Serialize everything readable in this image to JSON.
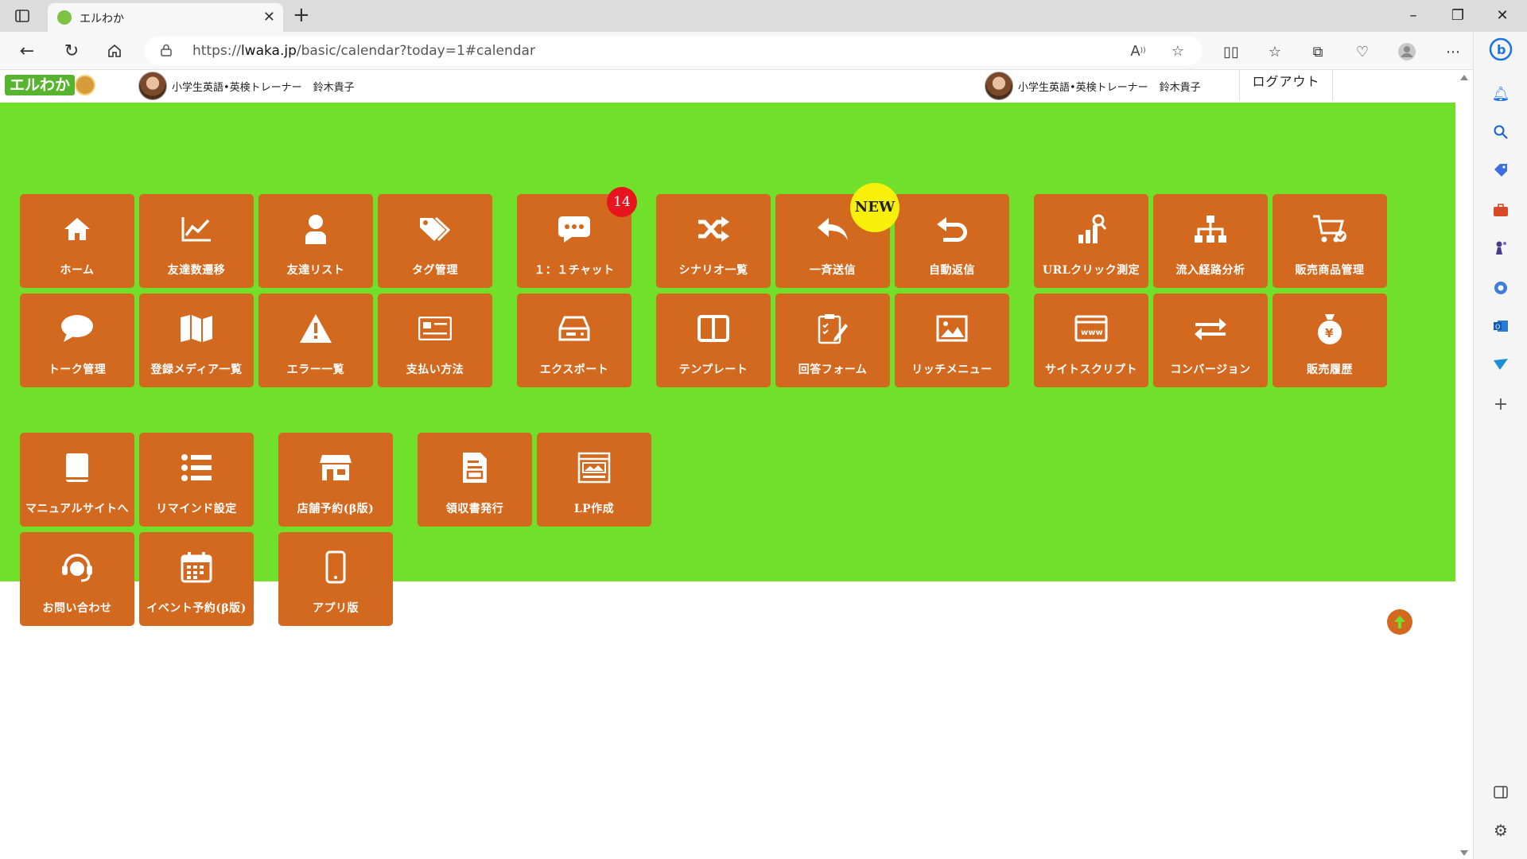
{
  "browser": {
    "tab_title": "エルわか",
    "url_prefix": "https://",
    "url_domain": "lwaka.jp",
    "url_path": "/basic/calendar?today=1#calendar"
  },
  "header": {
    "user_left": {
      "role": "小学生英語•英検トレーナー",
      "name": "鈴木貴子"
    },
    "user_right": {
      "role": "小学生英語•英検トレーナー",
      "name": "鈴木貴子"
    },
    "logout_label": "ログアウト",
    "logo_text": "エルわか"
  },
  "tiles": {
    "home": "ホーム",
    "friend_trend": "友達数遷移",
    "friend_list": "友達リスト",
    "tag_mgmt": "タグ管理",
    "chat": "１：１チャット",
    "scenario_list": "シナリオ一覧",
    "broadcast": "一斉送信",
    "auto_reply": "自動返信",
    "url_click": "URLクリック測定",
    "inflow": "流入経路分析",
    "product_mgmt": "販売商品管理",
    "talk_mgmt": "トーク管理",
    "media_list": "登録メディア一覧",
    "error_list": "エラー一覧",
    "payment": "支払い方法",
    "export": "エクスポート",
    "template": "テンプレート",
    "answer_form": "回答フォーム",
    "rich_menu": "リッチメニュー",
    "site_script": "サイトスクリプト",
    "conversion": "コンバージョン",
    "sales_history": "販売履歴",
    "manual": "マニュアルサイトへ",
    "remind": "リマインド設定",
    "store_reserve": "店舗予約(β版)",
    "receipt": "領収書発行",
    "lp": "LP作成",
    "contact": "お問い合わせ",
    "event_reserve": "イベント予約(β版)",
    "app": "アプリ版"
  },
  "badges": {
    "chat_count": "14",
    "new_label": "NEW"
  },
  "colors": {
    "background_green": "#70e02a",
    "tile_orange": "#d2691e",
    "badge_red": "#e8141e",
    "badge_yellow": "#f6f00a"
  }
}
